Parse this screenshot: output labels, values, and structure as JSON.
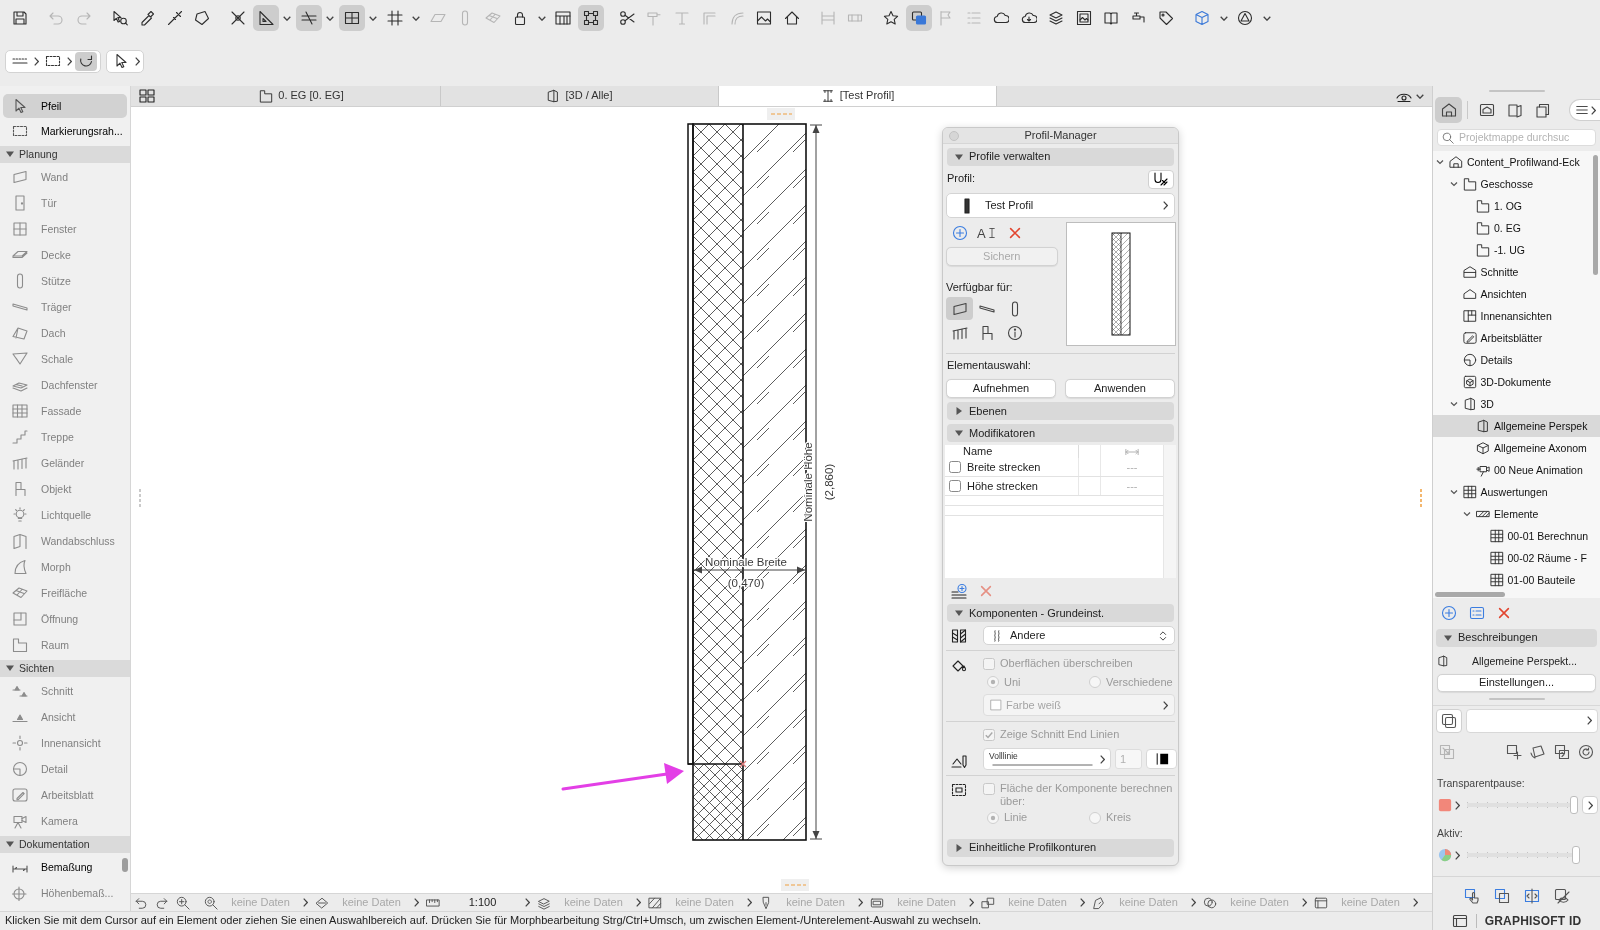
{
  "toolbar": [
    [
      {
        "active": false,
        "disabled": false,
        "menu": false
      }
    ],
    [
      {
        "active": false,
        "disabled": true,
        "menu": false
      },
      {
        "active": false,
        "disabled": true,
        "menu": false
      }
    ],
    [
      {
        "active": false,
        "disabled": false,
        "menu": false
      },
      {
        "active": false,
        "disabled": false,
        "menu": false
      },
      {
        "active": false,
        "disabled": false,
        "menu": false
      },
      {
        "active": false,
        "disabled": false,
        "menu": false
      }
    ],
    [
      {
        "active": false,
        "disabled": false,
        "menu": false
      },
      {
        "active": true,
        "disabled": false,
        "menu": true
      },
      {
        "active": true,
        "disabled": false,
        "menu": true
      },
      {
        "active": true,
        "disabled": false,
        "menu": true
      },
      {
        "active": false,
        "disabled": false,
        "menu": true
      },
      {
        "active": false,
        "disabled": true,
        "menu": false
      },
      {
        "active": false,
        "disabled": true,
        "menu": false
      },
      {
        "active": false,
        "disabled": true,
        "menu": false
      },
      {
        "active": false,
        "disabled": false,
        "menu": true
      },
      {
        "active": false,
        "disabled": false,
        "menu": false
      },
      {
        "active": true,
        "disabled": false,
        "menu": false
      }
    ],
    [
      {
        "active": false,
        "disabled": false,
        "menu": false
      },
      {
        "active": false,
        "disabled": true,
        "menu": false
      },
      {
        "active": false,
        "disabled": true,
        "menu": false
      },
      {
        "active": false,
        "disabled": true,
        "menu": false
      },
      {
        "active": false,
        "disabled": true,
        "menu": false
      },
      {
        "active": false,
        "disabled": false,
        "menu": false
      },
      {
        "active": false,
        "disabled": false,
        "menu": false
      }
    ],
    [
      {
        "active": false,
        "disabled": true,
        "menu": false
      },
      {
        "active": false,
        "disabled": true,
        "menu": false
      }
    ],
    [
      {
        "active": false,
        "disabled": false,
        "menu": false
      },
      {
        "active": true,
        "disabled": false,
        "menu": false
      },
      {
        "active": false,
        "disabled": true,
        "menu": false
      },
      {
        "active": false,
        "disabled": true,
        "menu": false
      },
      {
        "active": false,
        "disabled": false,
        "menu": false
      },
      {
        "active": false,
        "disabled": false,
        "menu": false
      },
      {
        "active": false,
        "disabled": false,
        "menu": false
      },
      {
        "active": false,
        "disabled": false,
        "menu": false
      },
      {
        "active": false,
        "disabled": false,
        "menu": false
      },
      {
        "active": false,
        "disabled": false,
        "menu": false
      },
      {
        "active": false,
        "disabled": false,
        "menu": false
      }
    ],
    [
      {
        "active": false,
        "disabled": false,
        "menu": true
      },
      {
        "active": false,
        "disabled": false,
        "menu": true
      }
    ]
  ],
  "quick_options": [
    [
      {
        "active": false,
        "menu": true
      },
      {
        "active": false,
        "menu": true
      },
      {
        "active": true,
        "menu": false
      }
    ],
    [
      {
        "active": false,
        "menu": true
      }
    ]
  ],
  "view_tabs": [
    {
      "label": "0. EG [0. EG]",
      "selected": false
    },
    {
      "label": "[3D / Alle]",
      "selected": false
    },
    {
      "label": "[Test Profil]",
      "selected": true
    }
  ],
  "toolbox": {
    "items": [
      {
        "label": "Pfeil",
        "selected": true,
        "disabled": false
      },
      {
        "label": "Markierungsrah...",
        "selected": false,
        "disabled": false
      }
    ],
    "sections": [
      {
        "title": "Planung",
        "expanded": true,
        "items": [
          {
            "label": "Wand",
            "selected": false,
            "disabled": true
          },
          {
            "label": "Tür",
            "selected": false,
            "disabled": true
          },
          {
            "label": "Fenster",
            "selected": false,
            "disabled": true
          },
          {
            "label": "Decke",
            "selected": false,
            "disabled": true
          },
          {
            "label": "Stütze",
            "selected": false,
            "disabled": true
          },
          {
            "label": "Träger",
            "selected": false,
            "disabled": true
          },
          {
            "label": "Dach",
            "selected": false,
            "disabled": true
          },
          {
            "label": "Schale",
            "selected": false,
            "disabled": true
          },
          {
            "label": "Dachfenster",
            "selected": false,
            "disabled": true
          },
          {
            "label": "Fassade",
            "selected": false,
            "disabled": true
          },
          {
            "label": "Treppe",
            "selected": false,
            "disabled": true
          },
          {
            "label": "Geländer",
            "selected": false,
            "disabled": true
          },
          {
            "label": "Objekt",
            "selected": false,
            "disabled": true
          },
          {
            "label": "Lichtquelle",
            "selected": false,
            "disabled": true
          },
          {
            "label": "Wandabschluss",
            "selected": false,
            "disabled": true
          },
          {
            "label": "Morph",
            "selected": false,
            "disabled": true
          },
          {
            "label": "Freifläche",
            "selected": false,
            "disabled": true
          },
          {
            "label": "Öffnung",
            "selected": false,
            "disabled": true
          },
          {
            "label": "Raum",
            "selected": false,
            "disabled": true
          }
        ]
      },
      {
        "title": "Sichten",
        "expanded": true,
        "items": [
          {
            "label": "Schnitt",
            "selected": false,
            "disabled": true
          },
          {
            "label": "Ansicht",
            "selected": false,
            "disabled": true
          },
          {
            "label": "Innenansicht",
            "selected": false,
            "disabled": true
          },
          {
            "label": "Detail",
            "selected": false,
            "disabled": true
          },
          {
            "label": "Arbeitsblatt",
            "selected": false,
            "disabled": true
          },
          {
            "label": "Kamera",
            "selected": false,
            "disabled": true
          }
        ]
      },
      {
        "title": "Dokumentation",
        "expanded": true,
        "items": [
          {
            "label": "Bemaßung",
            "selected": false,
            "disabled": false
          },
          {
            "label": "Höhenbemaß...",
            "selected": false,
            "disabled": true
          }
        ]
      }
    ]
  },
  "drawing": {
    "width_label": "Nominale Breite",
    "width_value": "(0,470)",
    "height_label": "Nominale Höhe",
    "height_value": "(2,860)"
  },
  "profile_manager": {
    "title": "Profil-Manager",
    "manage": {
      "title": "Profile verwalten",
      "expanded": true,
      "profile_label": "Profil:",
      "profile": "Test Profil",
      "rename_glyph": "A",
      "save_button": {
        "label": "Sichern",
        "disabled": true
      },
      "available_label": "Verfügbar für:",
      "available_for": [
        {
          "selected": true
        },
        {
          "selected": false
        },
        {
          "selected": false
        },
        {
          "selected": false
        },
        {
          "selected": false
        },
        {
          "selected": false
        }
      ],
      "selection_label": "Elementauswahl:",
      "buttons": [
        "Aufnehmen",
        "Anwenden"
      ]
    },
    "layers": {
      "title": "Ebenen",
      "expanded": false
    },
    "modifiers": {
      "title": "Modifikatoren",
      "expanded": true,
      "columns": [
        "Name"
      ],
      "rows": [
        {
          "name": "Breite strecken",
          "checked": false,
          "value": "---"
        },
        {
          "name": "Höhe strecken",
          "checked": false,
          "value": "---"
        }
      ]
    },
    "components": {
      "title": "Komponenten - Grundeinst.",
      "expanded": true,
      "fill": "Andere",
      "groups": [
        {
          "kind": "surfaces",
          "disabled": true,
          "checkbox": {
            "label": "Oberflächen überschreiben",
            "checked": false
          },
          "options": [
            {
              "label": "Uni",
              "selected": true
            },
            {
              "label": "Verschiedene",
              "selected": false
            }
          ],
          "material": "Farbe weiß"
        },
        {
          "kind": "lines",
          "disabled": true,
          "checkbox": {
            "label": "Zeige Schnitt End Linien",
            "checked": true
          },
          "line_type": "Volllinie",
          "pen": "1"
        },
        {
          "kind": "area",
          "disabled": true,
          "checkbox": {
            "label": "Fläche der Komponente berechnen über:",
            "checked": false
          },
          "options": [
            {
              "label": "Linie",
              "selected": true
            },
            {
              "label": "Kreis",
              "selected": false
            }
          ]
        }
      ]
    },
    "contours": {
      "title": "Einheitliche Profilkonturen",
      "expanded": false
    }
  },
  "status_bar": [
    {
      "text": "keine Daten",
      "disabled": true
    },
    {
      "text": "keine Daten",
      "disabled": true
    },
    {
      "text": "1:100",
      "disabled": false
    },
    {
      "text": "keine Daten",
      "disabled": true
    },
    {
      "text": "keine Daten",
      "disabled": true
    },
    {
      "text": "keine Daten",
      "disabled": true
    },
    {
      "text": "keine Daten",
      "disabled": true
    },
    {
      "text": "keine Daten",
      "disabled": true
    },
    {
      "text": "keine Daten",
      "disabled": true
    },
    {
      "text": "keine Daten",
      "disabled": true
    },
    {
      "text": "keine Daten",
      "disabled": true
    }
  ],
  "message": "Klicken Sie mit dem Cursor auf ein Element oder ziehen Sie einen Auswahlbereich auf. Drücken Sie für Morphbearbeitung Strg/Ctrl+Umsch, um zwischen Element-/Unterelement-Auswahl zu wechseln.",
  "navigator": {
    "tabs": [
      {
        "selected": true
      },
      {
        "selected": false
      },
      {
        "selected": false
      },
      {
        "selected": false
      }
    ],
    "search_placeholder": "Projektmappe durchsuc",
    "tree": [
      {
        "label": "Content_Profilwand-Eck",
        "selected": false,
        "expanded": true,
        "children": [
          {
            "label": "Geschosse",
            "selected": false,
            "expanded": true,
            "children": [
              {
                "label": "1. OG",
                "selected": false
              },
              {
                "label": "0. EG",
                "selected": false
              },
              {
                "label": "-1. UG",
                "selected": false
              }
            ]
          },
          {
            "label": "Schnitte",
            "selected": false
          },
          {
            "label": "Ansichten",
            "selected": false
          },
          {
            "label": "Innenansichten",
            "selected": false
          },
          {
            "label": "Arbeitsblätter",
            "selected": false
          },
          {
            "label": "Details",
            "selected": false
          },
          {
            "label": "3D-Dokumente",
            "selected": false
          },
          {
            "label": "3D",
            "selected": false,
            "expanded": true,
            "children": [
              {
                "label": "Allgemeine Perspek",
                "selected": true
              },
              {
                "label": "Allgemeine Axonom",
                "selected": false
              },
              {
                "label": "00 Neue Animation",
                "selected": false
              }
            ]
          },
          {
            "label": "Auswertungen",
            "selected": false,
            "expanded": true,
            "children": [
              {
                "label": "Elemente",
                "selected": false,
                "expanded": true,
                "children": [
                  {
                    "label": "00-01 Berechnun",
                    "selected": false
                  },
                  {
                    "label": "00-02 Räume - F",
                    "selected": false
                  },
                  {
                    "label": "01-00 Bauteile",
                    "selected": false
                  }
                ]
              }
            ]
          }
        ]
      }
    ],
    "descriptions": {
      "title": "Beschreibungen",
      "expanded": true,
      "item": "Allgemeine Perspekt...",
      "button": "Einstellungen..."
    },
    "overlay": {
      "transparency": {
        "label": "Transparentpause:",
        "level": 1
      },
      "active": {
        "label": "Aktiv:",
        "level": 1
      }
    }
  },
  "footer": "GRAPHISOFT ID"
}
